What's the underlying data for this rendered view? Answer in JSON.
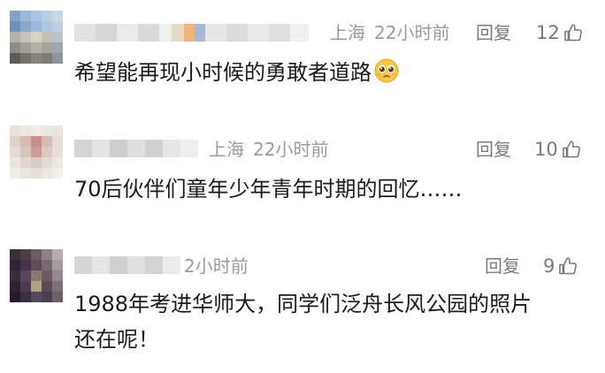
{
  "comments": [
    {
      "location": "上海",
      "time": "22小时前",
      "reply_label": "回复",
      "likes": "12",
      "text": "希望能再现小时候的勇敢者道路"
    },
    {
      "location": "上海",
      "time": "22小时前",
      "reply_label": "回复",
      "likes": "10",
      "text": "70后伙伴们童年少年青年时期的回忆……"
    },
    {
      "time": "2小时前",
      "reply_label": "回复",
      "likes": "9",
      "text_line1": "1988年考进华师大，同学们泛舟长风公园的照片",
      "text_line2": "还在呢！"
    }
  ],
  "icons": {
    "like": "thumbs-up-icon",
    "emoji": "pleading-face-emoji"
  },
  "colors": {
    "meta_gray": "#9b9b9b",
    "action_gray": "#7a7a7a",
    "text": "#1a1a1a",
    "emoji_yellow": "#f7c844"
  }
}
